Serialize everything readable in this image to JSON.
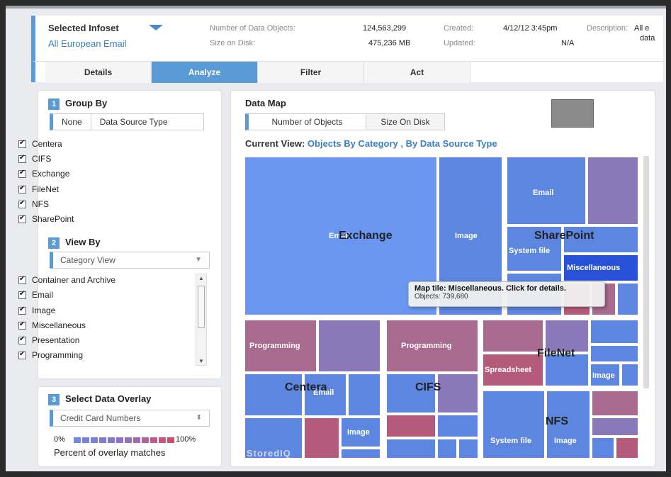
{
  "header": {
    "selected_label": "Selected Infoset",
    "selected_value": "All European Email",
    "num_objects_label": "Number of Data Objects:",
    "num_objects_value": "124,563,299",
    "size_label": "Size on Disk:",
    "size_value": "475,236 MB",
    "created_label": "Created:",
    "created_value": "4/12/12 3:45pm",
    "updated_label": "Updated:",
    "updated_value": "N/A",
    "description_label": "Description:",
    "description_value_1": "All e",
    "description_value_2": "data"
  },
  "tabs": [
    "Details",
    "Analyze",
    "Filter",
    "Act"
  ],
  "group_by": {
    "number": "1",
    "title": "Group By",
    "options": [
      "None",
      "Data Source Type"
    ],
    "items": [
      "Centera",
      "CIFS",
      "Exchange",
      "FileNet",
      "NFS",
      "SharePoint"
    ]
  },
  "view_by": {
    "number": "2",
    "title": "View By",
    "select": "Category View",
    "items": [
      "Container and Archive",
      "Email",
      "Image",
      "Miscellaneous",
      "Presentation",
      "Programming"
    ]
  },
  "overlay": {
    "number": "3",
    "title": "Select Data Overlay",
    "select": "Credit Card Numbers",
    "legend_min": "0%",
    "legend_max": "100%",
    "legend_caption": "Percent of overlay matches"
  },
  "datamap": {
    "title": "Data Map",
    "toggle": [
      "Number of Objects",
      "Size On Disk"
    ],
    "current_view_label": "Current View:",
    "current_view_value": "Objects By Category , By Data Source Type",
    "groups": {
      "exchange": "Exchange",
      "sharepoint": "SharePoint",
      "centera": "Centera",
      "cifs": "CIFS",
      "filenet": "FileNet",
      "nfs": "NFS"
    },
    "tiles": {
      "email": "Email",
      "image": "Image",
      "system_file": "System file",
      "miscellaneous": "Miscellaneous",
      "programming": "Programming",
      "spreadsheet": "Spreadsheet"
    },
    "tooltip_title": "Map tile: Miscellaneous. Click for details.",
    "tooltip_detail": "Objects: 739,680",
    "watermark": "StoredIQ"
  },
  "colors": {
    "accent": "#5b9bd5",
    "tile_blue": "#5c86e0",
    "tile_purple": "#8a78b8",
    "tile_rose": "#b45a7a",
    "tile_highlight": "#2851d8"
  }
}
